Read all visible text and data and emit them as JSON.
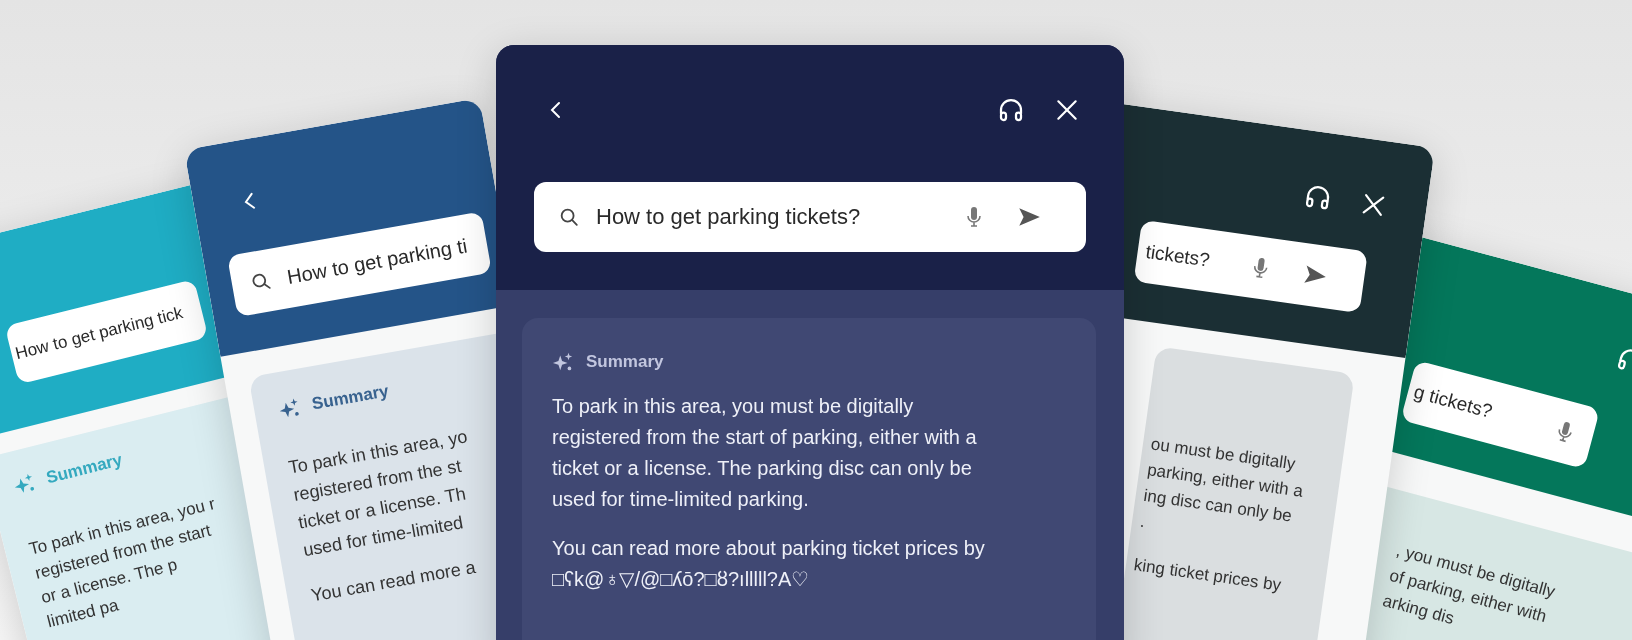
{
  "panels": [
    {
      "color": "#1fadc4",
      "kind": "light",
      "search": {
        "value": "How to get parking tick"
      },
      "summary": {
        "label": "Summary",
        "paragraphs": [
          [
            "To park in this area, you r",
            "registered from the start",
            "or a license. The p",
            "limited pa"
          ]
        ]
      }
    },
    {
      "color": "#245488",
      "kind": "light",
      "header": {
        "back": true
      },
      "search": {
        "value": "How to get parking ti",
        "search_icon": true
      },
      "summary": {
        "label": "Summary",
        "paragraphs": [
          [
            "To park in this area, yo",
            "registered from the st",
            "ticket or a license. Th",
            "used for time-limited"
          ],
          [
            "You can read more a"
          ]
        ]
      }
    },
    {
      "color": "#1a2148",
      "kind": "dark",
      "header": {
        "back": true,
        "headset": true,
        "close": true
      },
      "search": {
        "value": "How to get parking tickets?",
        "search_icon": true,
        "mic": true,
        "send": true
      },
      "summary": {
        "label": "Summary",
        "paragraphs": [
          [
            "To park in this area, you must be digitally",
            "registered from the start of parking, either with a",
            "ticket or a license. The parking disc can only be",
            "used for time-limited parking."
          ],
          [
            "You can read more about parking ticket prices by",
            "□ʕk@♁▽/@□ʎō?□ȣ?ılllll?A♡"
          ]
        ]
      }
    },
    {
      "color": "#1b2f34",
      "kind": "light",
      "header": {
        "headset": true,
        "close": true
      },
      "search": {
        "value": "tickets?",
        "mic": true,
        "send": true
      },
      "summary": {
        "paragraphs": [
          [
            "ou must be digitally",
            "parking, either with a",
            "ing disc can only be",
            "."
          ],
          [
            "king ticket prices by"
          ]
        ]
      }
    },
    {
      "color": "#04775b",
      "kind": "light",
      "header": {
        "headset": true
      },
      "search": {
        "value": "g tickets?",
        "mic": true
      },
      "summary": {
        "paragraphs": [
          [
            ", you must be digitally",
            "of parking, either with",
            "arking dis"
          ]
        ]
      }
    }
  ]
}
